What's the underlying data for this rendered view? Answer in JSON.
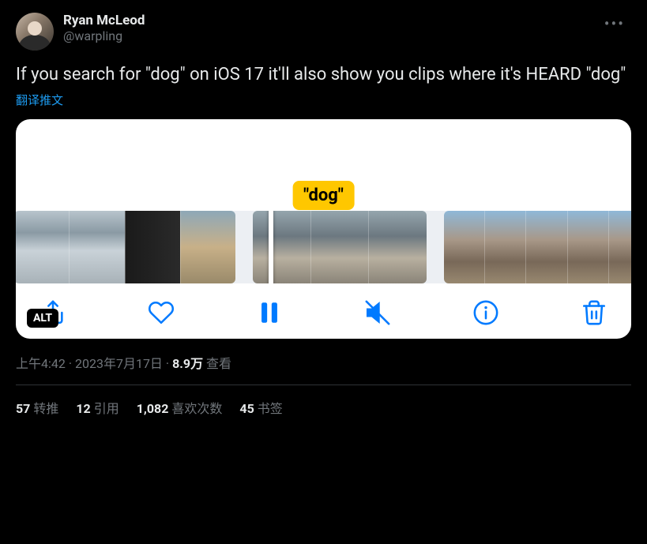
{
  "author": {
    "display_name": "Ryan McLeod",
    "handle": "@warpling"
  },
  "tweet_text": "If you search for \"dog\" on iOS 17 it'll also show you clips where it's HEARD \"dog\"",
  "translate_label": "翻译推文",
  "media": {
    "search_term": "\"dog\"",
    "alt_badge": "ALT"
  },
  "meta": {
    "time": "上午4:42",
    "date": "2023年7月17日",
    "views_count": "8.9万",
    "views_label": "查看",
    "separator": " · "
  },
  "stats": {
    "retweets": {
      "count": "57",
      "label": "转推"
    },
    "quotes": {
      "count": "12",
      "label": "引用"
    },
    "likes": {
      "count": "1,082",
      "label": "喜欢次数"
    },
    "bookmarks": {
      "count": "45",
      "label": "书签"
    }
  }
}
